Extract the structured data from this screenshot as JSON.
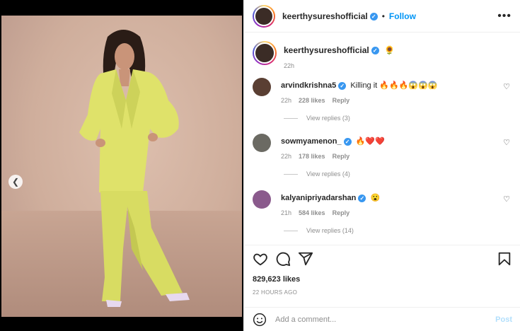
{
  "post": {
    "photo_icon": "photo-of-woman-in-yellow-suit",
    "carousel": {
      "dot_count": 5,
      "active_index": 4
    }
  },
  "header": {
    "username": "keerthysureshofficial",
    "follow_label": "Follow",
    "more_icon": "•••"
  },
  "caption": {
    "username": "keerthysureshofficial",
    "emoji": "🌻",
    "time": "22h"
  },
  "comments": [
    {
      "username": "arvindkrishna5",
      "text": "Killing it 🔥🔥🔥😱😱😱",
      "time": "22h",
      "likes": "228 likes",
      "reply": "Reply",
      "view_replies": "View replies (3)"
    },
    {
      "username": "sowmyamenon_",
      "text": "🔥❤️❤️",
      "time": "22h",
      "likes": "178 likes",
      "reply": "Reply",
      "view_replies": "View replies (4)"
    },
    {
      "username": "kalyanipriyadarshan",
      "text": "😮",
      "time": "21h",
      "likes": "584 likes",
      "reply": "Reply",
      "view_replies": "View replies (14)"
    }
  ],
  "engagement": {
    "likes": "829,623 likes",
    "posted": "22 HOURS AGO"
  },
  "comment_box": {
    "placeholder": "Add a comment...",
    "post_label": "Post"
  },
  "colors": {
    "accent": "#0095f6",
    "verified": "#3897f0",
    "muted": "#8e8e8e"
  }
}
